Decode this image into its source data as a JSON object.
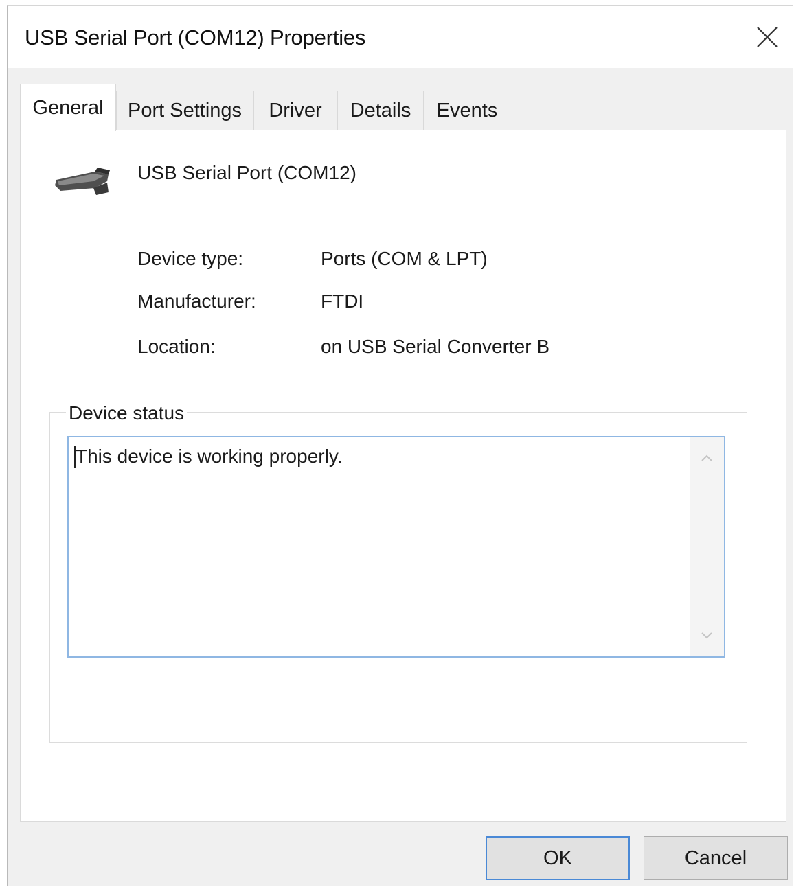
{
  "window": {
    "title": "USB Serial Port (COM12) Properties",
    "close_icon": "close-icon"
  },
  "tabs": [
    {
      "label": "General",
      "active": true
    },
    {
      "label": "Port Settings",
      "active": false
    },
    {
      "label": "Driver",
      "active": false
    },
    {
      "label": "Details",
      "active": false
    },
    {
      "label": "Events",
      "active": false
    }
  ],
  "general": {
    "device_icon": "serial-port-icon",
    "device_name": "USB Serial Port (COM12)",
    "properties": [
      {
        "label": "Device type:",
        "value": "Ports (COM & LPT)"
      },
      {
        "label": "Manufacturer:",
        "value": "FTDI"
      },
      {
        "label": "Location:",
        "value": "on USB Serial Converter B"
      }
    ],
    "status_group_label": "Device status",
    "status_text": "This device is working properly."
  },
  "buttons": {
    "ok_label": "OK",
    "cancel_label": "Cancel"
  },
  "colors": {
    "dialog_bg": "#f0f0f0",
    "panel_bg": "#ffffff",
    "focus_border": "#4a89d6",
    "status_border": "#8fb7e3"
  }
}
